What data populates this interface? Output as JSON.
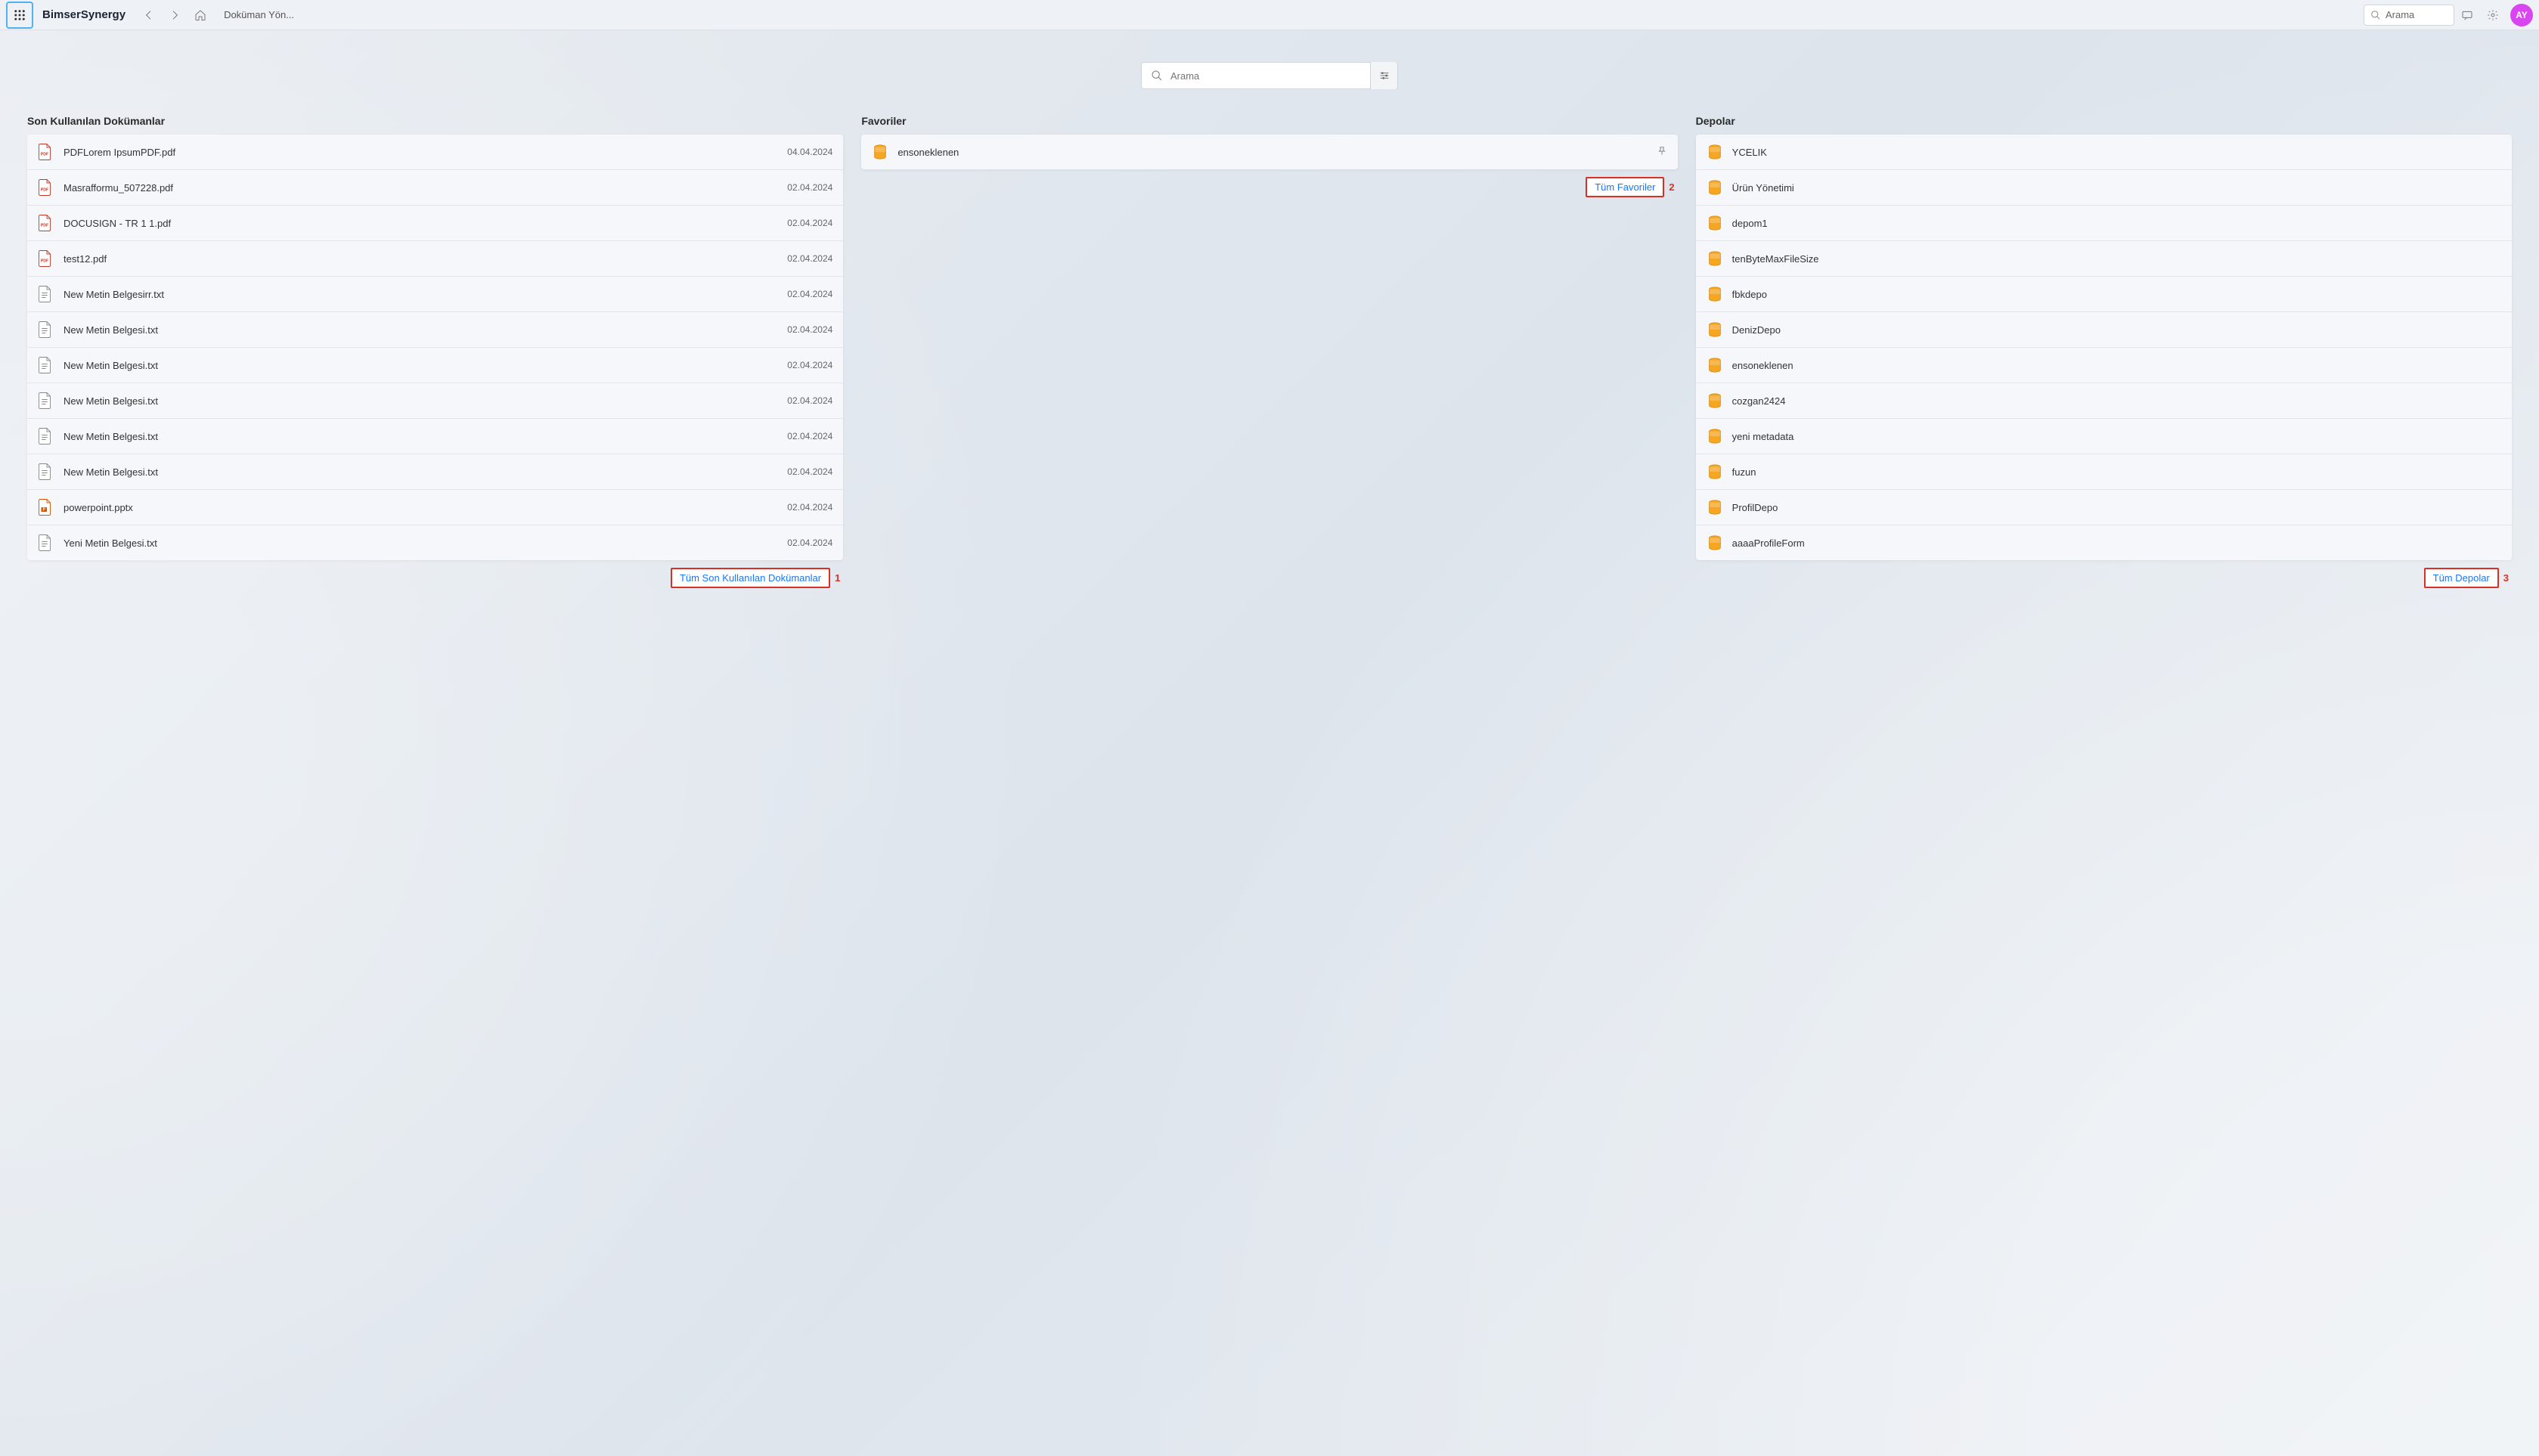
{
  "header": {
    "brand": "BimserSynergy",
    "breadcrumb": "Doküman Yön...",
    "search_label": "Arama",
    "avatar_initials": "AY"
  },
  "hero_search": {
    "placeholder": "Arama"
  },
  "columns": {
    "recent": {
      "title": "Son Kullanılan Dokümanlar",
      "items": [
        {
          "name": "PDFLorem IpsumPDF.pdf",
          "date": "04.04.2024",
          "type": "pdf"
        },
        {
          "name": "Masrafformu_507228.pdf",
          "date": "02.04.2024",
          "type": "pdf"
        },
        {
          "name": "DOCUSIGN - TR 1 1.pdf",
          "date": "02.04.2024",
          "type": "pdf"
        },
        {
          "name": "test12.pdf",
          "date": "02.04.2024",
          "type": "pdf"
        },
        {
          "name": "New Metin Belgesirr.txt",
          "date": "02.04.2024",
          "type": "txt"
        },
        {
          "name": "New Metin Belgesi.txt",
          "date": "02.04.2024",
          "type": "txt"
        },
        {
          "name": "New Metin Belgesi.txt",
          "date": "02.04.2024",
          "type": "txt"
        },
        {
          "name": "New Metin Belgesi.txt",
          "date": "02.04.2024",
          "type": "txt"
        },
        {
          "name": "New Metin Belgesi.txt",
          "date": "02.04.2024",
          "type": "txt"
        },
        {
          "name": "New Metin Belgesi.txt",
          "date": "02.04.2024",
          "type": "txt"
        },
        {
          "name": "powerpoint.pptx",
          "date": "02.04.2024",
          "type": "pptx"
        },
        {
          "name": "Yeni Metin Belgesi.txt",
          "date": "02.04.2024",
          "type": "txt"
        }
      ],
      "footer_label": "Tüm Son Kullanılan Dokümanlar",
      "footer_anno": "1"
    },
    "favorites": {
      "title": "Favoriler",
      "items": [
        {
          "name": "ensoneklenen",
          "pinned": true
        }
      ],
      "footer_label": "Tüm Favoriler",
      "footer_anno": "2"
    },
    "repos": {
      "title": "Depolar",
      "items": [
        {
          "name": "YCELIK"
        },
        {
          "name": "Ürün Yönetimi"
        },
        {
          "name": "depom1"
        },
        {
          "name": "tenByteMaxFileSize"
        },
        {
          "name": "fbkdepo"
        },
        {
          "name": "DenizDepo"
        },
        {
          "name": "ensoneklenen"
        },
        {
          "name": "cozgan2424"
        },
        {
          "name": "yeni metadata"
        },
        {
          "name": "fuzun"
        },
        {
          "name": "ProfilDepo"
        },
        {
          "name": "aaaaProfileForm"
        }
      ],
      "footer_label": "Tüm Depolar",
      "footer_anno": "3"
    }
  }
}
